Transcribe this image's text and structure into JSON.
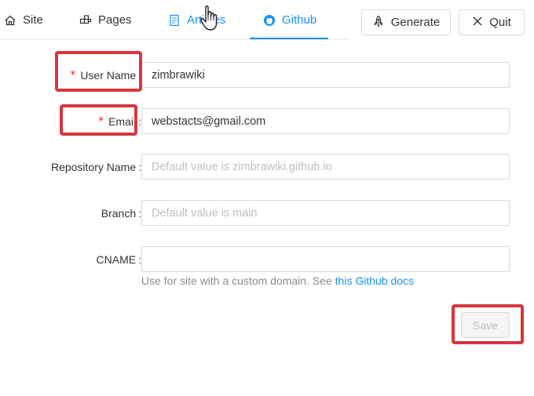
{
  "nav": {
    "tabs": [
      {
        "label": "Site",
        "icon": "home-icon"
      },
      {
        "label": "Pages",
        "icon": "pages-icon"
      },
      {
        "label": "Articles",
        "icon": "document-icon"
      },
      {
        "label": "Github",
        "icon": "github-icon",
        "active": true
      }
    ],
    "generate_label": "Generate",
    "quit_label": "Quit"
  },
  "form": {
    "username": {
      "label": "User Name",
      "required": true,
      "value": "zimbrawiki"
    },
    "email": {
      "label": "Email",
      "required": true,
      "value": "webstacts@gmail.com"
    },
    "repository": {
      "label": "Repository Name",
      "placeholder": "Default value is zimbrawiki.github.io"
    },
    "branch": {
      "label": "Branch",
      "placeholder": "Default value is main"
    },
    "cname": {
      "label": "CNAME",
      "value": ""
    },
    "hint_text": "Use for site with a custom domain. See",
    "hint_link": "this Github docs",
    "save_label": "Save"
  },
  "colors": {
    "accent": "#1890ff",
    "required": "#f5222d",
    "highlight": "#d9363e"
  }
}
